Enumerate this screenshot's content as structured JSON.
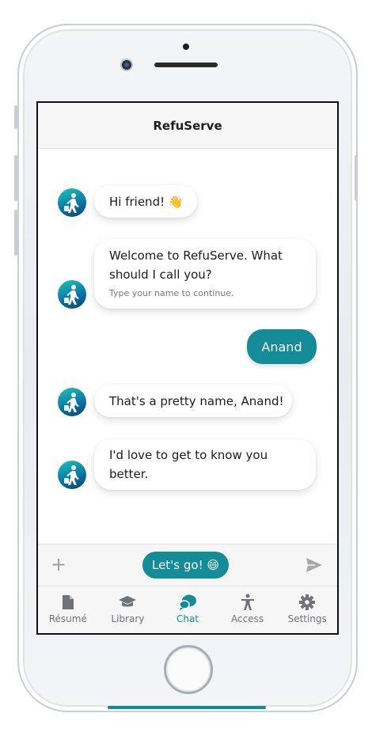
{
  "app": {
    "title": "RefuServe"
  },
  "messages": [
    {
      "from": "bot",
      "text": "Hi friend! 👋"
    },
    {
      "from": "bot",
      "text": "Welcome to RefuServe. What should I call you?",
      "hint": "Type your name to continue."
    },
    {
      "from": "user",
      "text": "Anand"
    },
    {
      "from": "bot",
      "text": "That's a pretty name, Anand!"
    },
    {
      "from": "bot",
      "text": "I'd love to get to know you better."
    }
  ],
  "composer": {
    "quick_reply": "Let's go! 😄"
  },
  "tabs": [
    {
      "label": "Résumé",
      "icon": "document-icon"
    },
    {
      "label": "Library",
      "icon": "graduation-cap-icon"
    },
    {
      "label": "Chat",
      "icon": "chat-bubbles-icon",
      "active": true
    },
    {
      "label": "Access",
      "icon": "accessibility-icon"
    },
    {
      "label": "Settings",
      "icon": "gear-icon"
    }
  ],
  "colors": {
    "accent": "#138c97",
    "header_bg": "#f6f6f7",
    "avatar_gradient": [
      "#1fc7b6",
      "#08416f"
    ]
  }
}
